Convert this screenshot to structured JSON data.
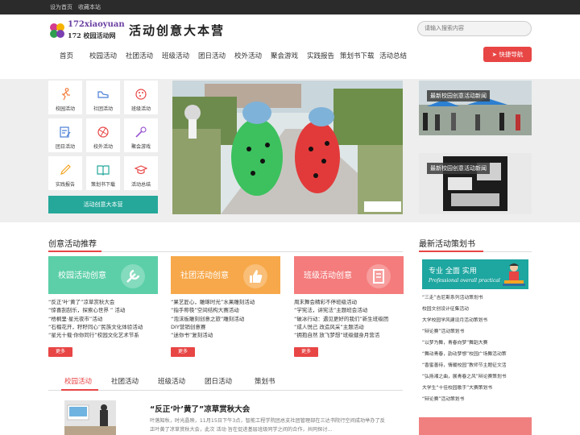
{
  "topbar": {
    "set_home": "设为首页",
    "bookmark": "收藏本站"
  },
  "header": {
    "logo_en": "172xiaoyuan",
    "logo_cn": "172 校园活动网",
    "slogan": "活动创意大本营",
    "search_placeholder": "请输入搜索内容"
  },
  "nav": {
    "items": [
      "首页",
      "校园活动",
      "社团活动",
      "班级活动",
      "团日活动",
      "校外活动",
      "聚会游戏",
      "实践报告",
      "策划书下载",
      "活动总结"
    ],
    "quick_nav": "快捷导航"
  },
  "categories": [
    {
      "label": "校园活动",
      "icon": "running-person-icon"
    },
    {
      "label": "社团活动",
      "icon": "sneaker-icon"
    },
    {
      "label": "班级活动",
      "icon": "palette-icon"
    },
    {
      "label": "团日活动",
      "icon": "document-edit-icon"
    },
    {
      "label": "校外活动",
      "icon": "ball-icon"
    },
    {
      "label": "聚会游戏",
      "icon": "microphone-icon"
    },
    {
      "label": "实践报告",
      "icon": "pencil-icon"
    },
    {
      "label": "策划书下载",
      "icon": "book-icon"
    },
    {
      "label": "活动总结",
      "icon": "graduation-cap-icon"
    }
  ],
  "main_button": "活动创意大本营",
  "side_cards": [
    {
      "caption": "最新校园创意活动新闻"
    },
    {
      "caption": "最新校园创意活动新闻"
    }
  ],
  "sections": {
    "recommend_title": "创意活动推荐",
    "plans_title": "最新活动策划书"
  },
  "cards": [
    {
      "title": "校园活动创意",
      "color": "#5ccfa8",
      "items": [
        "“反正‘叶’黄了”凉草赏秋大会",
        "“惊喜刮刮乐，探索心世界 ” 活动",
        "“梧桐里·星光夜市”活动",
        "“石榴花开，籽籽同心”民族文化体验活动",
        "“星光十载·你你同行”校园文化艺术节系"
      ],
      "more": "更多"
    },
    {
      "title": "社团活动创意",
      "color": "#f7a84a",
      "items": [
        "“果艺匠心，雕琢时光”水果雕刻活动",
        "“指手称筷”空间结构大赛活动",
        "“泡沫板雕刻创意之旅”雕刻活动",
        "DIY营销创意赛",
        "“迷你书”复刻活动"
      ],
      "more": "更多"
    },
    {
      "title": "班级活动创意",
      "color": "#f47c7c",
      "items": [
        "周末舞会精彩不停班级活动",
        "“学宪法，讲宪法”主题班会活动",
        "“破冰行动：遇见更好的我们”新生班级团",
        "“成人悦己 改造风采”主题活动",
        "“拥抱自然 放飞梦想”班级健身月营活"
      ],
      "more": "更多"
    }
  ],
  "tabs": [
    "校园活动",
    "社团活动",
    "班级活动",
    "团日活动",
    "策划书"
  ],
  "article": {
    "title": "“反正‘叶’黄了”凉草赏秋大会",
    "excerpt": "叶落知秋，时光晶映，11月15日下午3点，智能工程学院团总支社团管理部在三达书院行空间成功举办了反正叶黄了凉草赏秋大会，此次 活动 旨在促进基层班级同学之间的合作，共同探讨..."
  },
  "promo": {
    "line1": "专业 全面 实用",
    "line2": "Professional overall practical"
  },
  "plan_list": [
    "“三走”吉尼斯系列活动策划书",
    "校园文创设计征集活动",
    "大学校园学风建设月活动策划书",
    "“辩论赛”活动策划书",
    "“以梦为舞，青春向梦”舞蹈大赛",
    "“舞动青春，韵动梦想”校园广场舞活动策",
    "“香蜜善待，情暖校园”教师节主题征文活",
    "“弘扬湘之曲，展青春之风”辩论赛策划书",
    "大学生“十佳校园歌手”大赛策划书",
    "“辩论赛”活动策划书"
  ],
  "colors": {
    "accent": "#e84545",
    "teal": "#25a89a",
    "topbar": "#2b2b2b"
  }
}
